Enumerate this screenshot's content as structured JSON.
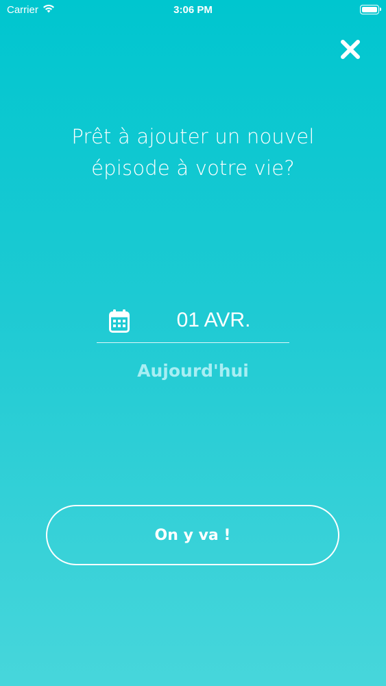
{
  "status_bar": {
    "carrier": "Carrier",
    "time": "3:06 PM",
    "wifi_icon": "wifi-icon",
    "battery_icon": "battery-icon"
  },
  "header": {
    "close_icon": "close-icon"
  },
  "main": {
    "title": "Prêt à ajouter un nouvel\népisode à votre vie?",
    "date_picker": {
      "icon": "calendar-icon",
      "value": "01 AVR.",
      "subtitle": "Aujourd'hui"
    },
    "cta_label": "On y va !"
  },
  "colors": {
    "background_top": "#00C6CF",
    "background_bottom": "#47D6DB",
    "text": "#FFFFFF",
    "subtitle_text": "#A8EEF3"
  }
}
